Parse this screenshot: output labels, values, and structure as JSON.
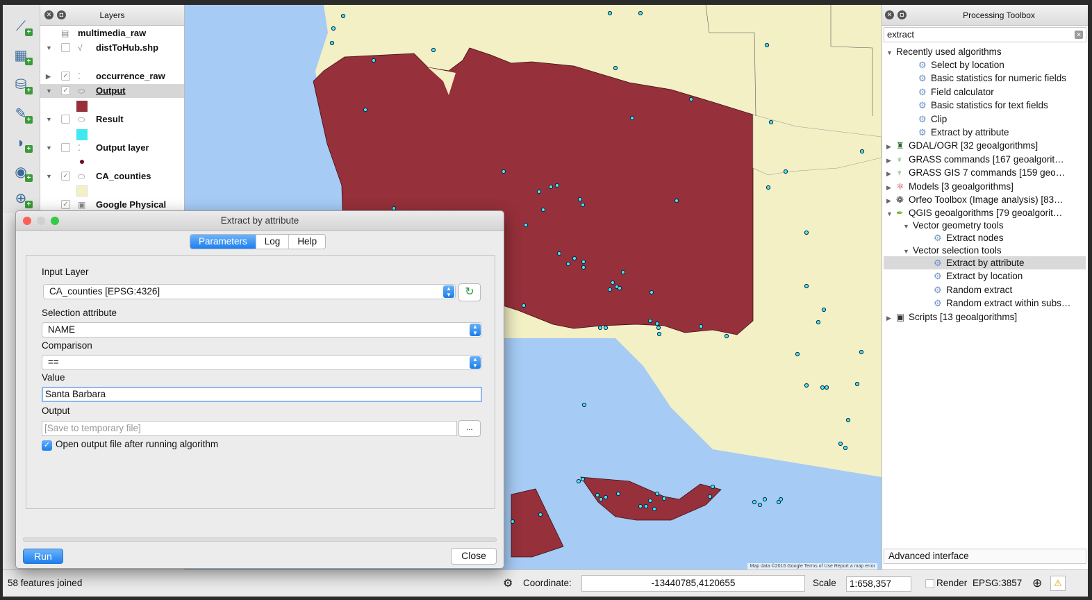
{
  "toolstrip": {
    "icons": [
      "add-vector-layer-icon",
      "add-raster-layer-icon",
      "add-postgis-layer-icon",
      "new-shapefile-layer-icon",
      "add-wms-layer-icon",
      "add-wcs-layer-icon",
      "add-wfs-layer-icon"
    ]
  },
  "layers_panel": {
    "title": "Layers",
    "items": [
      {
        "name": "multimedia_raw",
        "icon": "table-icon"
      },
      {
        "name": "distToHub.shp",
        "icon": "line-icon"
      },
      {
        "name": "occurrence_raw",
        "icon": "point-icon"
      },
      {
        "name": "Output",
        "icon": "polygon-icon"
      },
      {
        "name": "Result",
        "icon": "polygon-icon"
      },
      {
        "name": "Output layer",
        "icon": "point-icon"
      },
      {
        "name": "CA_counties",
        "icon": "polygon-icon"
      },
      {
        "name": "Google Physical",
        "icon": "raster-icon"
      }
    ],
    "swatches": {
      "output": "#96303a",
      "result": "#42e8f0",
      "output_layer": "#6a1020",
      "ca_counties": "#f3f0c5"
    }
  },
  "toolbox": {
    "title": "Processing Toolbox",
    "search_value": "extract",
    "recent_group": "Recently used algorithms",
    "recent": [
      "Select by location",
      "Basic statistics for numeric fields",
      "Field calculator",
      "Basic statistics for text fields",
      "Clip",
      "Extract by attribute"
    ],
    "providers": {
      "gdal": "GDAL/OGR [32 geoalgorithms]",
      "grass": "GRASS commands [167 geoalgorit…",
      "grass7": "GRASS GIS 7 commands [159 geo…",
      "models": "Models [3 geoalgorithms]",
      "orfeo": "Orfeo Toolbox (Image analysis) [83…",
      "qgis": "QGIS geoalgorithms [79 geoalgorit…",
      "scripts": "Scripts [13 geoalgorithms]"
    },
    "vector_geometry": "Vector geometry tools",
    "extract_nodes": "Extract nodes",
    "vector_selection": "Vector selection tools",
    "selection_items": [
      "Extract by attribute",
      "Extract by location",
      "Random extract",
      "Random extract within subs…"
    ],
    "advanced": "Advanced interface"
  },
  "dialog": {
    "title": "Extract by attribute",
    "tabs": [
      "Parameters",
      "Log",
      "Help"
    ],
    "input_layer_label": "Input Layer",
    "input_layer_value": "CA_counties [EPSG:4326]",
    "selection_attribute_label": "Selection attribute",
    "selection_attribute_value": "NAME",
    "comparison_label": "Comparison",
    "comparison_value": "==",
    "value_label": "Value",
    "value_value": "Santa Barbara",
    "output_label": "Output",
    "output_placeholder": "[Save to temporary file]",
    "browse_label": "...",
    "open_output_label": "Open output file after running algorithm",
    "run_label": "Run",
    "close_label": "Close"
  },
  "map": {
    "attribution": "Map data ©2016 Google  Terms of Use  Report a map error",
    "colors": {
      "ocean": "#a6cbf5",
      "land": "#f3f0c5",
      "selected": "#96303a",
      "points": "#42e8f0"
    }
  },
  "statusbar": {
    "message": "58 features joined",
    "coordinate_label": "Coordinate:",
    "coordinate_value": "-13440785,4120655",
    "scale_label": "Scale",
    "scale_value": "1:658,357",
    "render_label": "Render",
    "crs": "EPSG:3857"
  }
}
